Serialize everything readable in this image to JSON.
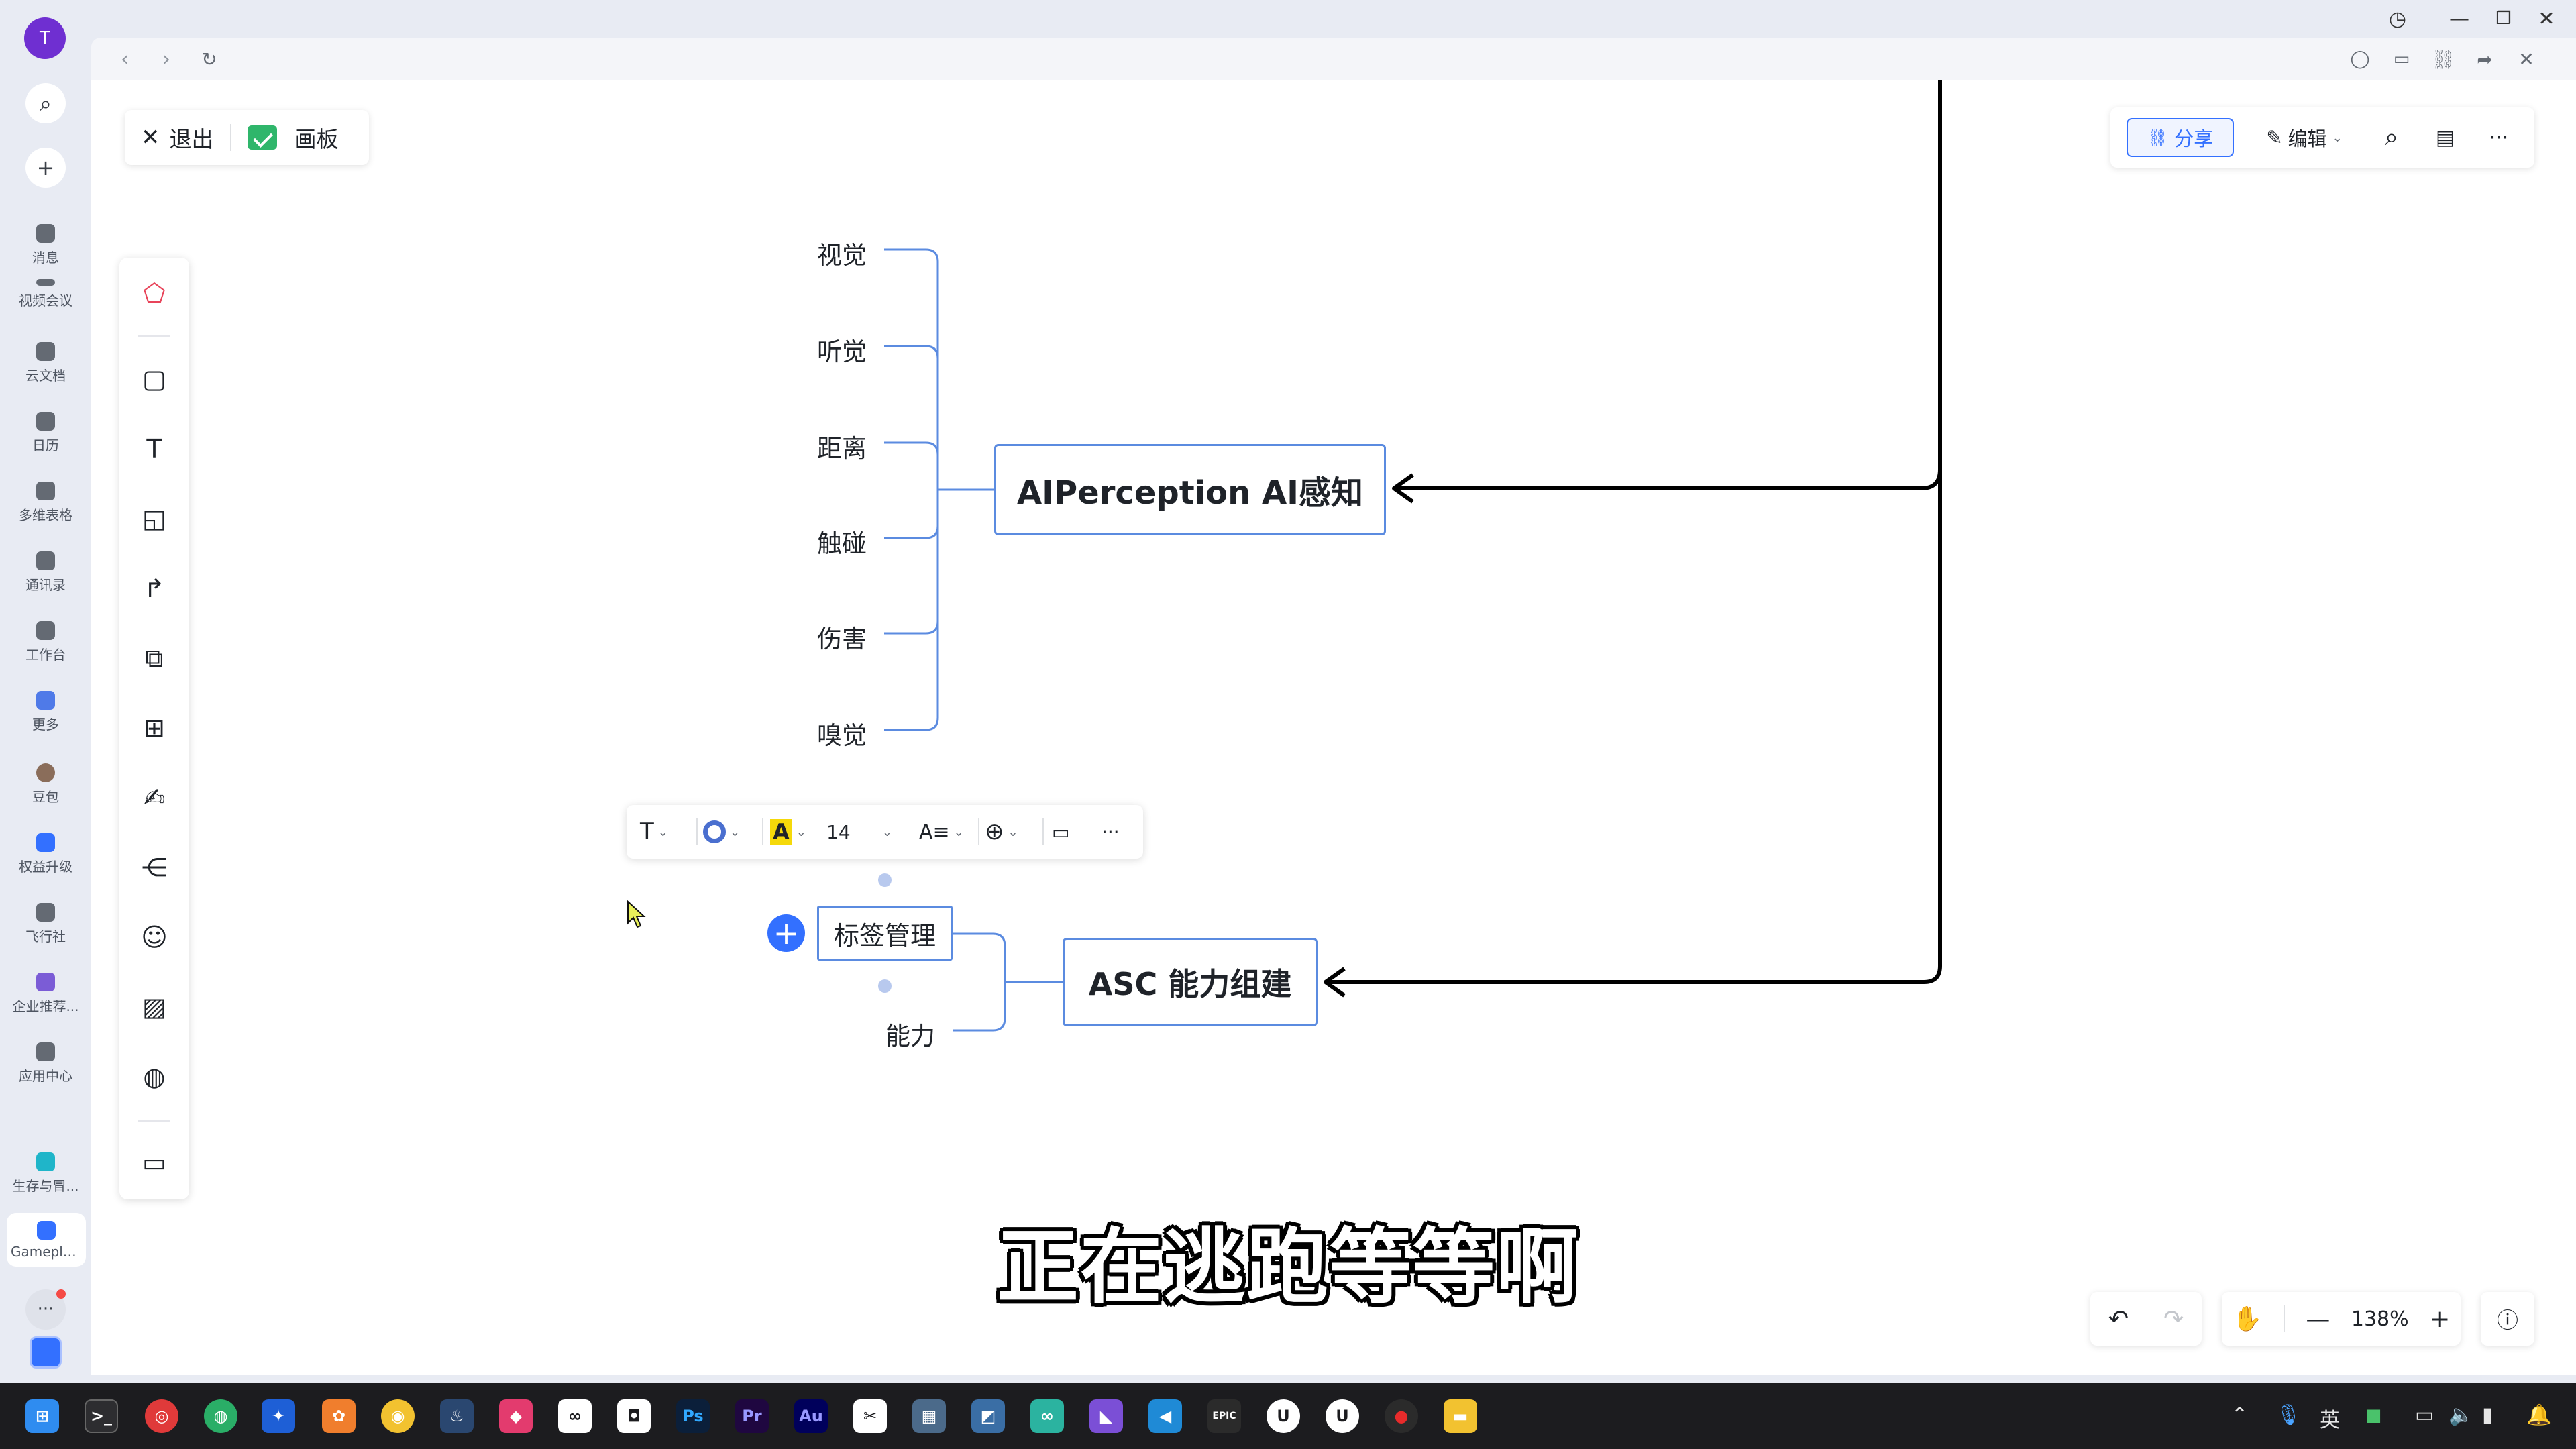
{
  "rail": {
    "avatar_letter": "T",
    "items": [
      {
        "label": "消息"
      },
      {
        "label": "视频会议"
      },
      {
        "label": "云文档"
      },
      {
        "label": "日历"
      },
      {
        "label": "多维表格"
      },
      {
        "label": "通讯录"
      },
      {
        "label": "工作台"
      },
      {
        "label": "更多"
      },
      {
        "label": "豆包"
      },
      {
        "label": "权益升级"
      },
      {
        "label": "飞行社"
      },
      {
        "label": "企业推荐..."
      },
      {
        "label": "应用中心"
      },
      {
        "label": "生存与冒..."
      },
      {
        "label": "Gamepla..."
      }
    ]
  },
  "board": {
    "exit_label": "退出",
    "board_label": "画板"
  },
  "toolbar": {
    "share_label": "分享",
    "edit_label": "编辑"
  },
  "mindmap": {
    "perception_leaves": [
      "视觉",
      "听觉",
      "距离",
      "触碰",
      "伤害",
      "嗅觉"
    ],
    "perception_node": "AIPerception AI感知",
    "asc_node": "ASC 能力组建",
    "tag_node": "标签管理",
    "ability_leaf": "能力"
  },
  "format_bar": {
    "font_size": "14",
    "highlight_letter": "A"
  },
  "subtitle": "正在逃跑等等啊",
  "zoom": {
    "level": "138%"
  },
  "colors": {
    "accent": "#3370ff",
    "node_border": "#5b8be0",
    "avatar": "#6f2fd1"
  }
}
